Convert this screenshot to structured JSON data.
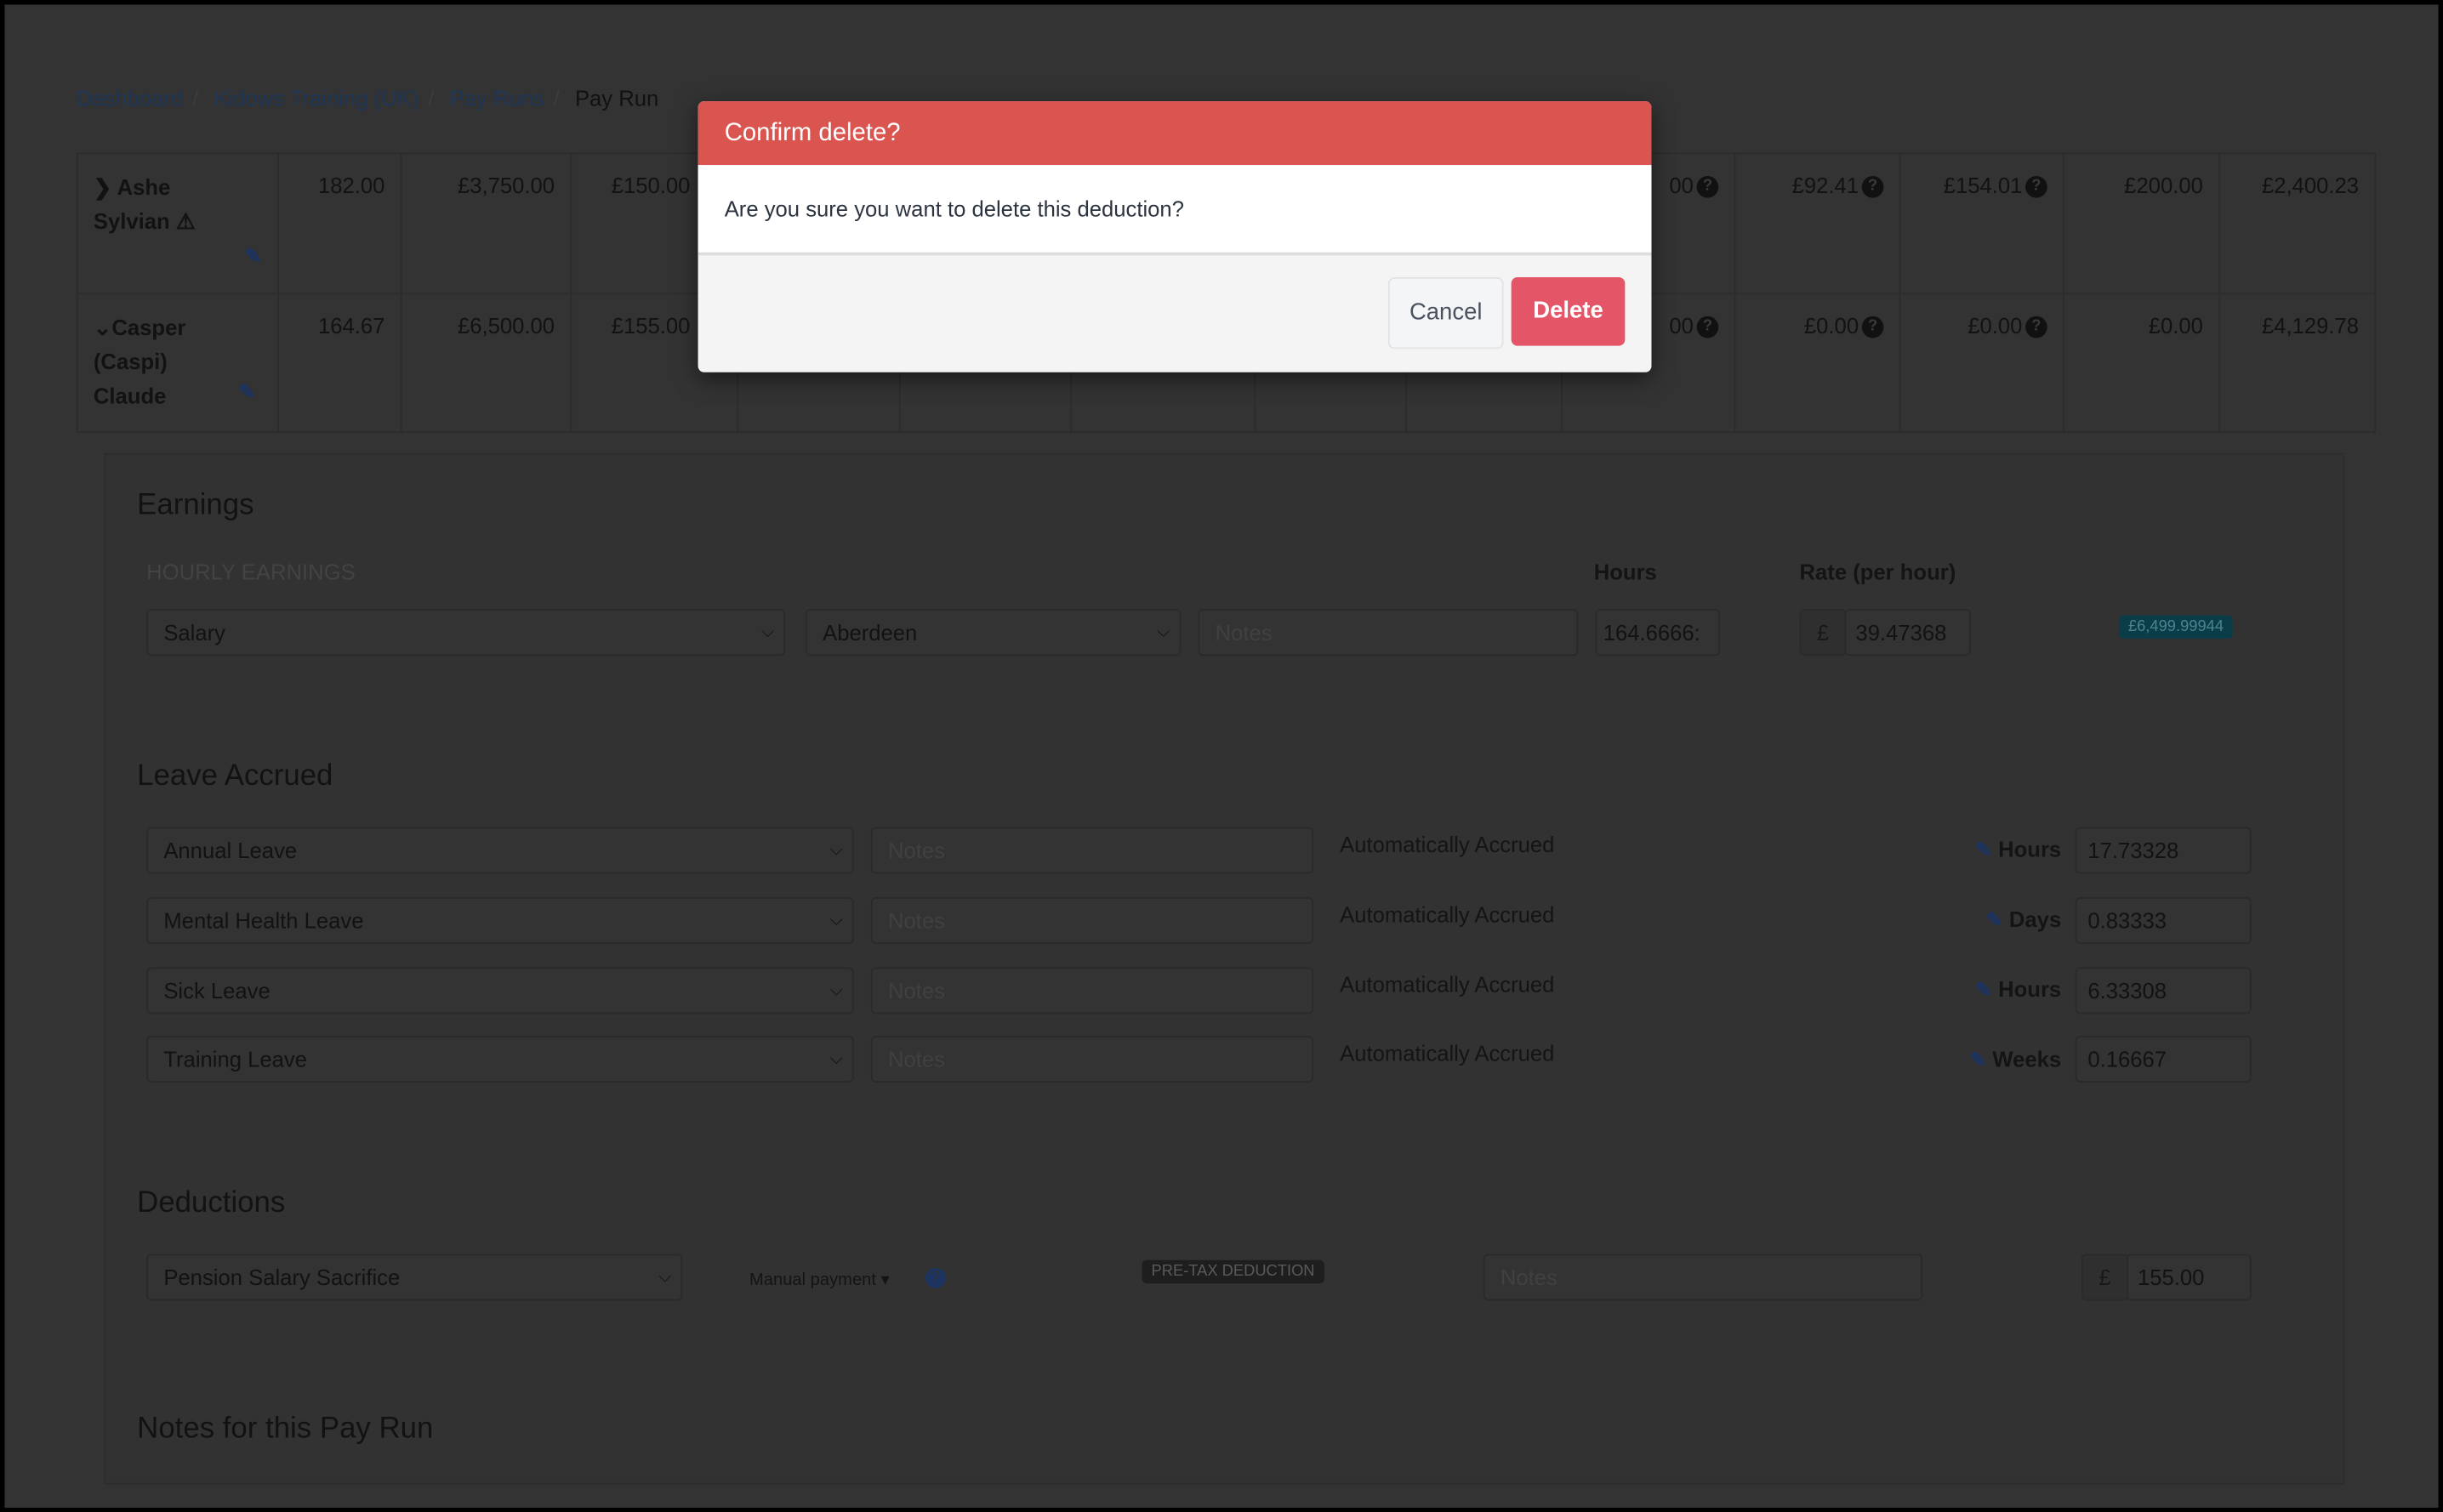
{
  "breadcrumb": {
    "items": [
      "Dashboard",
      "Kidows Training (UK)",
      "Pay Runs"
    ],
    "current": "Pay Run"
  },
  "table": {
    "rows": [
      {
        "name_line1": "Ashe",
        "name_line2": "Sylvian",
        "name_line3": "",
        "expand_icon": "chevron-right",
        "warning": true,
        "cells": [
          "182.00",
          "£3,750.00",
          "£150.00",
          "",
          "",
          "",
          "",
          "",
          "00",
          "£92.41",
          "£154.01",
          "£200.00",
          "£2,400.23"
        ]
      },
      {
        "name_line1": "Casper",
        "name_line2": "(Caspi)",
        "name_line3": "Claude",
        "expand_icon": "chevron-down",
        "warning": false,
        "cells": [
          "164.67",
          "£6,500.00",
          "£155.00",
          "",
          "",
          "",
          "",
          "",
          "00",
          "£0.00",
          "£0.00",
          "£0.00",
          "£4,129.78"
        ]
      }
    ]
  },
  "earnings": {
    "title": "Earnings",
    "section_label": "HOURLY EARNINGS",
    "hours_label": "Hours",
    "rate_label": "Rate (per hour)",
    "type": "Salary",
    "location": "Aberdeen",
    "notes_placeholder": "Notes",
    "hours": "164.6666:",
    "currency": "£",
    "rate": "39.47368",
    "total_badge": "£6,499.99944",
    "badge_color": "#0e5a6a"
  },
  "leave": {
    "title": "Leave Accrued",
    "rows": [
      {
        "type": "Annual Leave",
        "notes_placeholder": "Notes",
        "status": "Automatically Accrued",
        "unit": "Hours",
        "value": "17.73328"
      },
      {
        "type": "Mental Health Leave",
        "notes_placeholder": "Notes",
        "status": "Automatically Accrued",
        "unit": "Days",
        "value": "0.83333"
      },
      {
        "type": "Sick Leave",
        "notes_placeholder": "Notes",
        "status": "Automatically Accrued",
        "unit": "Hours",
        "value": "6.33308"
      },
      {
        "type": "Training Leave",
        "notes_placeholder": "Notes",
        "status": "Automatically Accrued",
        "unit": "Weeks",
        "value": "0.16667"
      }
    ]
  },
  "deductions": {
    "title": "Deductions",
    "type": "Pension Salary Sacrifice",
    "payment": "Manual payment",
    "badge": "PRE-TAX DEDUCTION",
    "notes_placeholder": "Notes",
    "currency": "£",
    "amount": "155.00"
  },
  "notes_section": {
    "title": "Notes for this Pay Run"
  },
  "modal": {
    "title": "Confirm delete?",
    "message": "Are you sure you want to delete this deduction?",
    "cancel_label": "Cancel",
    "delete_label": "Delete",
    "header_color": "#db5550",
    "delete_color": "#e45567"
  }
}
